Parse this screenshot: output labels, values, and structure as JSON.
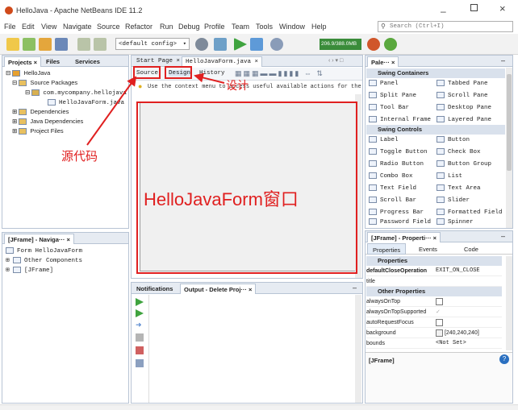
{
  "window": {
    "title": "HelloJava - Apache NetBeans IDE 11.2"
  },
  "menu": [
    "File",
    "Edit",
    "View",
    "Navigate",
    "Source",
    "Refactor",
    "Run",
    "Debug",
    "Profile",
    "Team",
    "Tools",
    "Window",
    "Help"
  ],
  "search": {
    "placeholder": "Search (Ctrl+I)"
  },
  "toolbar": {
    "config": "<default config>",
    "memory": "206.9/388.0MB"
  },
  "projects": {
    "tabs": [
      "Projects ×",
      "Files",
      "Services"
    ],
    "tree": [
      "HelloJava",
      "Source Packages",
      "com.mycompany.hellojava",
      "HelloJavaForm.java",
      "Dependencies",
      "Java Dependencies",
      "Project Files"
    ]
  },
  "editor": {
    "tabs": [
      "Start Page ×",
      "HelloJavaForm.java ×"
    ],
    "views": {
      "source": "Source",
      "design": "Design",
      "history": "History"
    },
    "hint": "Use the context menu to access useful available actions for the"
  },
  "navigator": {
    "title": "[JFrame] - Naviga··· ×",
    "tree": [
      "Form HelloJavaForm",
      "Other Components",
      "[JFrame]"
    ]
  },
  "output": {
    "tabs": [
      "Notifications",
      "Output - Delete Proj··· ×"
    ]
  },
  "palette": {
    "title": "Pale··· ×",
    "sections": [
      {
        "name": "Swing Containers",
        "items": [
          "Panel",
          "Tabbed Pane",
          "Split Pane",
          "Scroll Pane",
          "Tool Bar",
          "Desktop Pane",
          "Internal Frame",
          "Layered Pane"
        ]
      },
      {
        "name": "Swing Controls",
        "items": [
          "Label",
          "Button",
          "Toggle Button",
          "Check Box",
          "Radio Button",
          "Button Group",
          "Combo Box",
          "List",
          "Text Field",
          "Text Area",
          "Scroll Bar",
          "Slider",
          "Progress Bar",
          "Formatted Field",
          "Password Field",
          "Spinner"
        ]
      }
    ]
  },
  "properties": {
    "title": "[JFrame] - Properti··· ×",
    "tabs": [
      "Properties",
      "Events",
      "Code"
    ],
    "section1": "Properties",
    "rows1": [
      {
        "name": "defaultCloseOperation",
        "value": "EXIT_ON_CLOSE"
      },
      {
        "name": "title",
        "value": ""
      }
    ],
    "section2": "Other Properties",
    "rows2": [
      {
        "name": "alwaysOnTop",
        "value": ""
      },
      {
        "name": "alwaysOnTopSupported",
        "value": ""
      },
      {
        "name": "autoRequestFocus",
        "value": ""
      },
      {
        "name": "background",
        "value": "[240,240,240]"
      },
      {
        "name": "bounds",
        "value": "<Not Set>"
      }
    ],
    "footer": "[JFrame]"
  },
  "annotations": {
    "design": "设计",
    "source": "源代码",
    "form": "HelloJavaForm窗口"
  },
  "colors": {
    "accent": "#e02020",
    "title_icon": "#d04a1a",
    "panel_border": "#b8c4d4"
  }
}
